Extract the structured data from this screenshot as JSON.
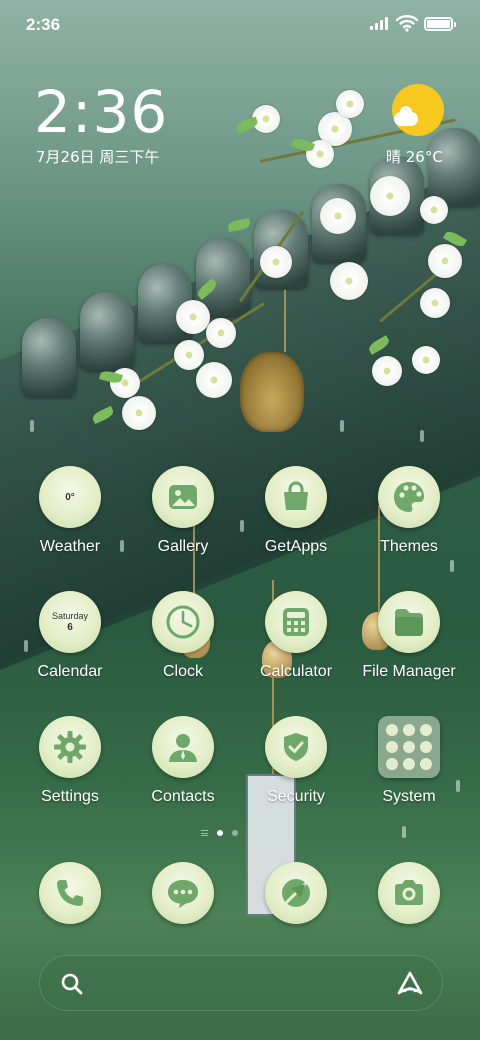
{
  "status_bar": {
    "time": "2:36",
    "battery_level": 1.0
  },
  "clock_widget": {
    "time": "2:36",
    "date": "7月26日 周三下午",
    "weather": "晴 26°C"
  },
  "apps": [
    {
      "id": "weather",
      "label": "Weather",
      "icon": "weather-icon",
      "icon_text": "0°"
    },
    {
      "id": "gallery",
      "label": "Gallery",
      "icon": "gallery-icon"
    },
    {
      "id": "getapps",
      "label": "GetApps",
      "icon": "shopping-bag-icon"
    },
    {
      "id": "themes",
      "label": "Themes",
      "icon": "palette-icon"
    },
    {
      "id": "calendar",
      "label": "Calendar",
      "icon": "calendar-icon",
      "icon_day": "Saturday",
      "icon_date": "6"
    },
    {
      "id": "clock",
      "label": "Clock",
      "icon": "clock-icon"
    },
    {
      "id": "calculator",
      "label": "Calculator",
      "icon": "calculator-icon"
    },
    {
      "id": "file_manager",
      "label": "File Manager",
      "icon": "folder-icon"
    },
    {
      "id": "settings",
      "label": "Settings",
      "icon": "gear-icon"
    },
    {
      "id": "contacts",
      "label": "Contacts",
      "icon": "person-icon"
    },
    {
      "id": "security",
      "label": "Security",
      "icon": "shield-check-icon"
    },
    {
      "id": "system",
      "label": "System",
      "icon": "app-folder-icon"
    }
  ],
  "dock": [
    {
      "id": "phone",
      "icon": "phone-icon"
    },
    {
      "id": "messages",
      "icon": "message-icon"
    },
    {
      "id": "browser",
      "icon": "compass-icon"
    },
    {
      "id": "camera",
      "icon": "camera-icon"
    }
  ],
  "page_indicator": {
    "pages": 2,
    "current": 1
  },
  "search_bar": {
    "left_icon": "search-icon",
    "right_icon": "assistant-icon"
  },
  "colors": {
    "icon_fill": "#e3eec8",
    "icon_glyph": "#6fa86a",
    "sun": "#f7c920"
  }
}
